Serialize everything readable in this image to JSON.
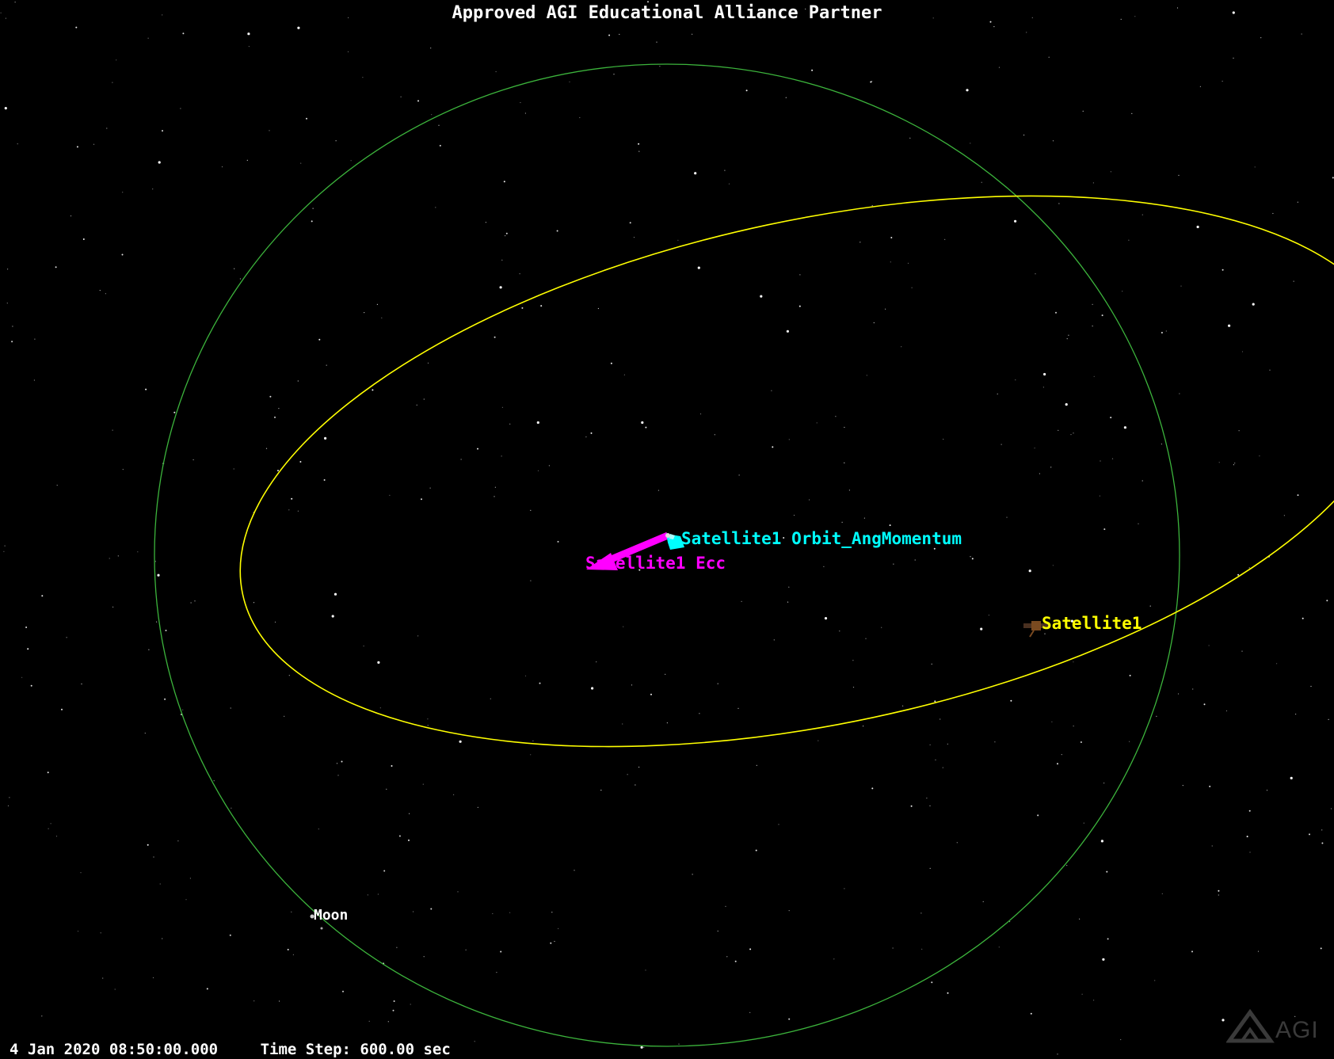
{
  "banner": {
    "text": "Approved AGI Educational Alliance Partner"
  },
  "labels": {
    "angular_momentum": "Satellite1 Orbit_AngMomentum",
    "eccentricity": "Satellite1 Ecc",
    "satellite": "Satellite1",
    "moon": "Moon"
  },
  "status": {
    "datetime": "4 Jan 2020 08:50:00.000",
    "time_step": "Time Step: 600.00 sec"
  },
  "logo": {
    "text": "AGI"
  },
  "colors": {
    "background": "#000000",
    "moon_orbit": "#3cb43c",
    "satellite_orbit": "#ffff00",
    "ang_momentum_vector": "#00ffff",
    "eccentricity_vector": "#ff00ff",
    "satellite_label": "#ffff00",
    "moon_label": "#ffffff"
  },
  "icons": {
    "satellite": "satellite-icon",
    "moon": "moon-icon"
  }
}
